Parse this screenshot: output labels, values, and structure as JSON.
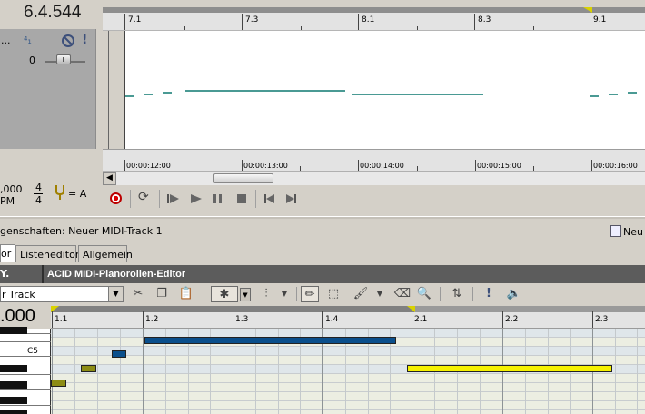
{
  "transport_time": "6.4.544",
  "track_header": {
    "dots": "...",
    "volume_value": "0",
    "tempo_line1": ",000",
    "tempo_line2": "PM",
    "time_sig_num": "4",
    "time_sig_den": "4",
    "key_label": "= A"
  },
  "upper_ruler": {
    "labels": [
      "7.1",
      "7.3",
      "8.1",
      "8.3",
      "9.1"
    ]
  },
  "time_ruler": {
    "labels": [
      "00:00:12:00",
      "00:00:13:00",
      "00:00:14:00",
      "00:00:15:00",
      "00:00:16:00"
    ]
  },
  "transport_buttons": [
    "record",
    "loop",
    "play-from-start",
    "play",
    "pause",
    "stop",
    "go-to-start",
    "go-to-end"
  ],
  "properties": {
    "title": "genschaften: Neuer MIDI-Track 1",
    "new_button": "Neu"
  },
  "tabs": [
    {
      "label": "or",
      "active": true
    },
    {
      "label": "Listeneditor",
      "active": false
    },
    {
      "label": "Allgemein",
      "active": false
    }
  ],
  "editor": {
    "logo": "Y.",
    "title": "ACID MIDI-Pianorollen-Editor",
    "track_select_value": "r Track",
    "position": ".000"
  },
  "piano_roll": {
    "bar_labels": [
      "1.1",
      "1.2",
      "1.3",
      "1.4",
      "2.1",
      "2.2",
      "2.3"
    ],
    "c5_label": "C5",
    "colors": {
      "selected_note": "#0a4f8c",
      "yellow_note": "#f5f100",
      "olive_note": "#8c8c14"
    }
  }
}
